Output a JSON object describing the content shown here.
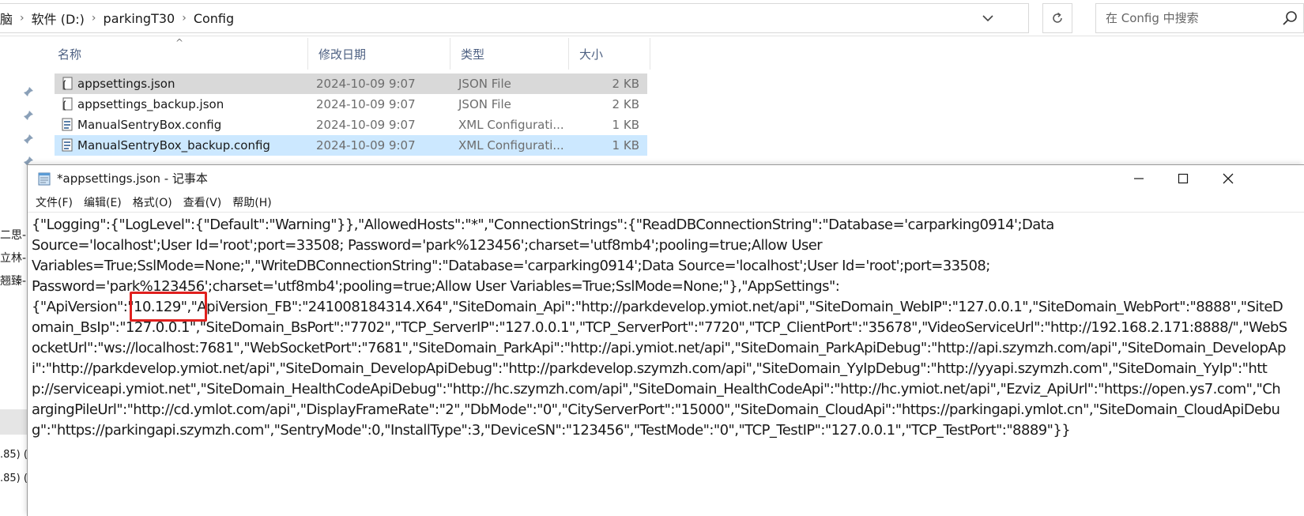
{
  "explorer": {
    "breadcrumb": [
      "脑",
      "软件 (D:)",
      "parkingT30",
      "Config"
    ],
    "search_placeholder": "在 Config 中搜索",
    "columns": {
      "name": "名称",
      "date": "修改日期",
      "type": "类型",
      "size": "大小"
    },
    "files": [
      {
        "name": "appsettings.json",
        "date": "2024-10-09 9:07",
        "type": "JSON File",
        "size": "2 KB"
      },
      {
        "name": "appsettings_backup.json",
        "date": "2024-10-09 9:07",
        "type": "JSON File",
        "size": "2 KB"
      },
      {
        "name": "ManualSentryBox.config",
        "date": "2024-10-09 9:07",
        "type": "XML Configurati...",
        "size": "1 KB"
      },
      {
        "name": "ManualSentryBox_backup.config",
        "date": "2024-10-09 9:07",
        "type": "XML Configurati...",
        "size": "1 KB"
      }
    ],
    "nav_fragments": [
      "二思-",
      "立林-",
      "翘臻-",
      ".85) (",
      ".85) ("
    ]
  },
  "notepad": {
    "title": "*appsettings.json - 记事本",
    "menu": [
      "文件(F)",
      "编辑(E)",
      "格式(O)",
      "查看(V)",
      "帮助(H)"
    ],
    "content": "{\"Logging\":{\"LogLevel\":{\"Default\":\"Warning\"}},\"AllowedHosts\":\"*\",\"ConnectionStrings\":{\"ReadDBConnectionString\":\"Database='carparking0914';Data\nSource='localhost';User Id='root';port=33508; Password='park%123456';charset='utf8mb4';pooling=true;Allow User\nVariables=True;SslMode=None;\",\"WriteDBConnectionString\":\"Database='carparking0914';Data Source='localhost';User Id='root';port=33508;\nPassword='park%123456';charset='utf8mb4';pooling=true;Allow User Variables=True;SslMode=None;\"},\"AppSettings\":\n{\"ApiVersion\":\"10.129\",\"ApiVersion_FB\":\"241008184314.X64\",\"SiteDomain_Api\":\"http://parkdevelop.ymiot.net/api\",\"SiteDomain_WebIP\":\"127.0.0.1\",\"SiteDomain_WebPort\":\"8888\",\"SiteDomain_BsIp\":\"127.0.0.1\",\"SiteDomain_BsPort\":\"7702\",\"TCP_ServerIP\":\"127.0.0.1\",\"TCP_ServerPort\":\"7720\",\"TCP_ClientPort\":\"35678\",\"VideoServiceUrl\":\"http://192.168.2.171:8888/\",\"WebSocketUrl\":\"ws://localhost:7681\",\"WebSocketPort\":\"7681\",\"SiteDomain_ParkApi\":\"http://api.ymiot.net/api\",\"SiteDomain_ParkApiDebug\":\"http://api.szymzh.com/api\",\"SiteDomain_DevelopApi\":\"http://parkdevelop.ymiot.net/api\",\"SiteDomain_DevelopApiDebug\":\"http://parkdevelop.szymzh.com/api\",\"SiteDomain_YyIpDebug\":\"http://yyapi.szymzh.com\",\"SiteDomain_YyIp\":\"http://serviceapi.ymiot.net\",\"SiteDomain_HealthCodeApiDebug\":\"http://hc.szymzh.com/api\",\"SiteDomain_HealthCodeApi\":\"http://hc.ymiot.net/api\",\"Ezviz_ApiUrl\":\"https://open.ys7.com\",\"ChargingPileUrl\":\"http://cd.ymlot.com/api\",\"DisplayFrameRate\":\"2\",\"DbMode\":\"0\",\"CityServerPort\":\"15000\",\"SiteDomain_CloudApi\":\"https://parkingapi.ymlot.cn\",\"SiteDomain_CloudApiDebug\":\"https://parkingapi.szymzh.com\",\"SentryMode\":0,\"InstallType\":3,\"DeviceSN\":\"123456\",\"TestMode\":\"0\",\"TCP_TestIP\":\"127.0.0.1\",\"TCP_TestPort\":\"8889\"}}"
  },
  "colors": {
    "highlight": "#e0201e",
    "selection_blue": "#cce8ff",
    "selection_gray": "#d9d9d9",
    "header_text": "#4d6082"
  }
}
